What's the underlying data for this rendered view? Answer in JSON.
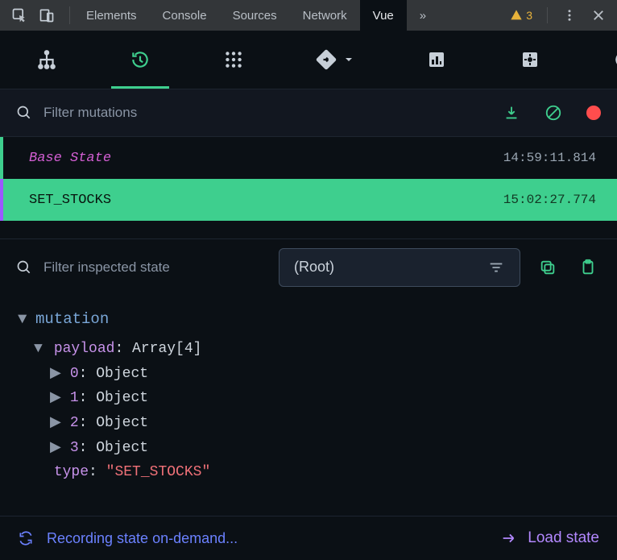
{
  "devtools_tabs": {
    "items": [
      "Elements",
      "Console",
      "Sources",
      "Network",
      "Vue"
    ],
    "active": "Vue",
    "warning_count": "3"
  },
  "toolbar": {
    "filter_placeholder": "Filter mutations"
  },
  "log": {
    "base_label": "Base State",
    "base_time": "14:59:11.814",
    "selected_label": "SET_STOCKS",
    "selected_time": "15:02:27.774"
  },
  "inspector": {
    "filter_placeholder": "Filter inspected state",
    "scope_label": "(Root)",
    "section_title": "mutation",
    "payload_key": "payload",
    "payload_value": "Array[4]",
    "items": [
      {
        "k": "0",
        "v": "Object"
      },
      {
        "k": "1",
        "v": "Object"
      },
      {
        "k": "2",
        "v": "Object"
      },
      {
        "k": "3",
        "v": "Object"
      }
    ],
    "type_key": "type",
    "type_value": "\"SET_STOCKS\""
  },
  "footer": {
    "status": "Recording state on-demand...",
    "action": "Load state"
  }
}
